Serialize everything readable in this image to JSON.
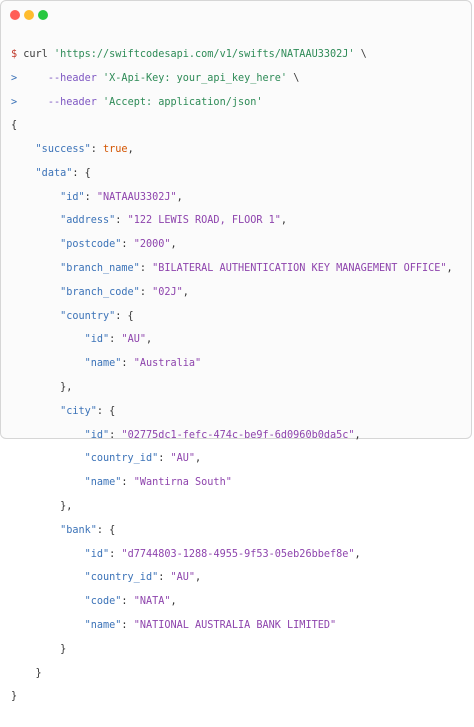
{
  "window": {
    "controls": [
      {
        "name": "close",
        "color": "#ff5f57"
      },
      {
        "name": "minimize",
        "color": "#febc2e"
      },
      {
        "name": "zoom",
        "color": "#28c840"
      }
    ]
  },
  "command": {
    "prompt": "$",
    "continuation": ">",
    "program": "curl",
    "url": "'https://swiftcodesapi.com/v1/swifts/NATAAU3302J'",
    "backslash": "\\",
    "header_flag": "--header",
    "header1": "'X-Api-Key: your_api_key_here'",
    "header2": "'Accept: application/json'"
  },
  "response": {
    "success_key": "\"success\"",
    "success_val": "true",
    "data_key": "\"data\"",
    "id_key": "\"id\"",
    "id_val": "\"NATAAU3302J\"",
    "address_key": "\"address\"",
    "address_val": "\"122 LEWIS ROAD, FLOOR 1\"",
    "postcode_key": "\"postcode\"",
    "postcode_val": "\"2000\"",
    "branch_name_key": "\"branch_name\"",
    "branch_name_val": "\"BILATERAL AUTHENTICATION KEY MANAGEMENT OFFICE\"",
    "branch_code_key": "\"branch_code\"",
    "branch_code_val": "\"02J\"",
    "country_key": "\"country\"",
    "country_id_val": "\"AU\"",
    "name_key": "\"name\"",
    "country_name_val": "\"Australia\"",
    "city_key": "\"city\"",
    "city_id_val": "\"02775dc1-fefc-474c-be9f-6d0960b0da5c\"",
    "country_id_key": "\"country_id\"",
    "city_country_id_val": "\"AU\"",
    "city_name_val": "\"Wantirna South\"",
    "bank_key": "\"bank\"",
    "bank_id_val": "\"d7744803-1288-4955-9f53-05eb26bbef8e\"",
    "bank_country_id_val": "\"AU\"",
    "code_key": "\"code\"",
    "bank_code_val": "\"NATA\"",
    "bank_name_val": "\"NATIONAL AUSTRALIA BANK LIMITED\""
  }
}
